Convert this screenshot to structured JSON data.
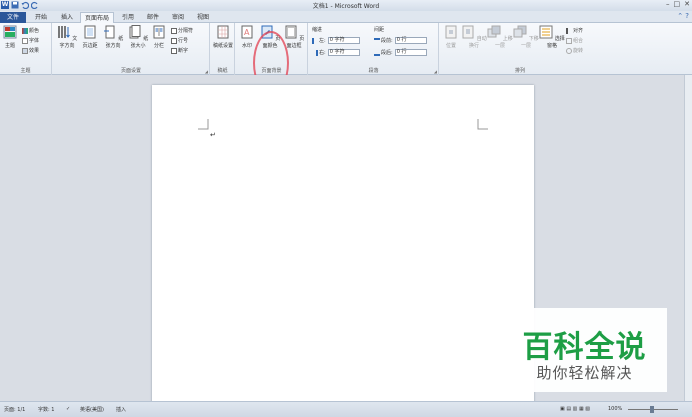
{
  "window": {
    "title": "文档1 - Microsoft Word",
    "logo_letter": "W"
  },
  "tabs": [
    {
      "label": "文件"
    },
    {
      "label": "开始"
    },
    {
      "label": "插入"
    },
    {
      "label": "页面布局"
    },
    {
      "label": "引用"
    },
    {
      "label": "邮件"
    },
    {
      "label": "审阅"
    },
    {
      "label": "视图"
    }
  ],
  "ribbon": {
    "themes": {
      "group_label": "主题",
      "themes_button": "主题",
      "colors": "颜色",
      "fonts": "字体",
      "effects": "效果"
    },
    "page_setup": {
      "group_label": "页面设置",
      "text_direction": "文字方向",
      "margins": "页边距",
      "orientation": "纸张方向",
      "size": "纸张大小",
      "columns": "分栏",
      "breaks": "分隔符",
      "line_numbers": "行号",
      "hyphenation": "断字"
    },
    "manuscript": {
      "group_label": "稿纸",
      "settings": "稿纸设置"
    },
    "page_background": {
      "group_label": "页面背景",
      "watermark": "水印",
      "page_color": "页面颜色",
      "page_borders": "页面边框"
    },
    "paragraph": {
      "group_label": "段落",
      "indent_heading": "缩进",
      "spacing_heading": "间距",
      "left_label": "左:",
      "right_label": "右:",
      "left_value": "0 字符",
      "right_value": "0 字符",
      "before_label": "段前:",
      "after_label": "段后:",
      "before_value": "0 行",
      "after_value": "0 行"
    },
    "arrange": {
      "group_label": "排列",
      "position": "位置",
      "wrap_text": "自动换行",
      "bring_forward": "上移一层",
      "send_backward": "下移一层",
      "selection_pane": "选择窗格",
      "align": "对齐",
      "group": "组合",
      "rotate": "旋转"
    }
  },
  "watermark_overlay": {
    "line1": "百科全说",
    "line2": "助你轻松解决"
  },
  "statusbar": {
    "page": "页面: 1/1",
    "words": "字数: 1",
    "language": "英语(美国)",
    "mode": "插入",
    "zoom": "100%",
    "zoom_level": 1.0
  },
  "colors": {
    "file_tab": "#2b579a",
    "annotation_circle": "#e24a5a",
    "watermark_green": "#1d9e45"
  }
}
